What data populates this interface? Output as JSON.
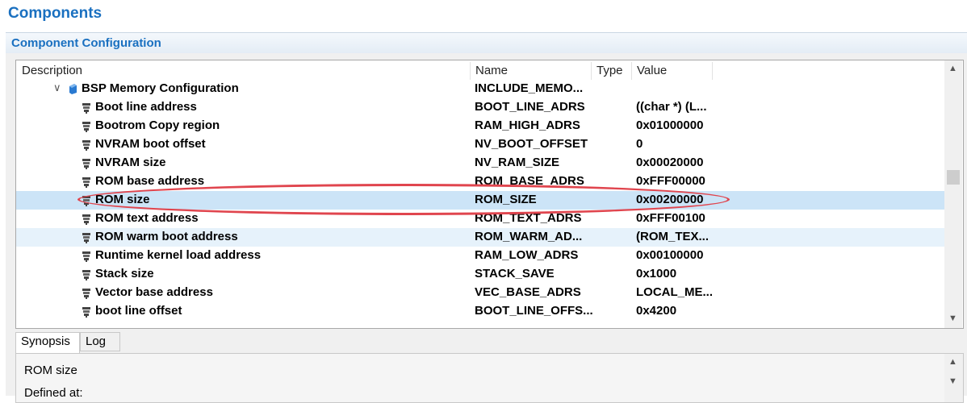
{
  "window": {
    "title": "Components"
  },
  "section": {
    "title": "Component Configuration"
  },
  "table": {
    "headers": {
      "description": "Description",
      "name": "Name",
      "type": "Type",
      "value": "Value"
    },
    "group": {
      "label": "BSP Memory Configuration",
      "name": "INCLUDE_MEMO..."
    },
    "rows": [
      {
        "description": "Boot line address",
        "name": "BOOT_LINE_ADRS",
        "value": "((char *) (L..."
      },
      {
        "description": "Bootrom Copy region",
        "name": "RAM_HIGH_ADRS",
        "value": "0x01000000"
      },
      {
        "description": "NVRAM boot offset",
        "name": "NV_BOOT_OFFSET",
        "value": "0"
      },
      {
        "description": "NVRAM size",
        "name": "NV_RAM_SIZE",
        "value": "0x00020000"
      },
      {
        "description": "ROM base address",
        "name": "ROM_BASE_ADRS",
        "value": "0xFFF00000"
      },
      {
        "description": "ROM size",
        "name": "ROM_SIZE",
        "value": "0x00200000"
      },
      {
        "description": "ROM text address",
        "name": "ROM_TEXT_ADRS",
        "value": "0xFFF00100"
      },
      {
        "description": "ROM warm boot address",
        "name": "ROM_WARM_AD...",
        "value": "(ROM_TEX..."
      },
      {
        "description": "Runtime kernel load address",
        "name": "RAM_LOW_ADRS",
        "value": "0x00100000"
      },
      {
        "description": "Stack size",
        "name": "STACK_SAVE",
        "value": "0x1000"
      },
      {
        "description": "Vector base address",
        "name": "VEC_BASE_ADRS",
        "value": "LOCAL_ME..."
      },
      {
        "description": "boot line offset",
        "name": "BOOT_LINE_OFFS...",
        "value": "0x4200"
      }
    ]
  },
  "tabs": {
    "synopsis": "Synopsis",
    "log": "Log"
  },
  "synopsis": {
    "line1": "ROM size",
    "line2": "Defined at:"
  },
  "colors": {
    "accent": "#1a70c0",
    "selected_row": "#cce4f7",
    "annotation": "#e0454e"
  },
  "icons": {
    "group": "component-group-icon",
    "param": "parameter-icon"
  }
}
